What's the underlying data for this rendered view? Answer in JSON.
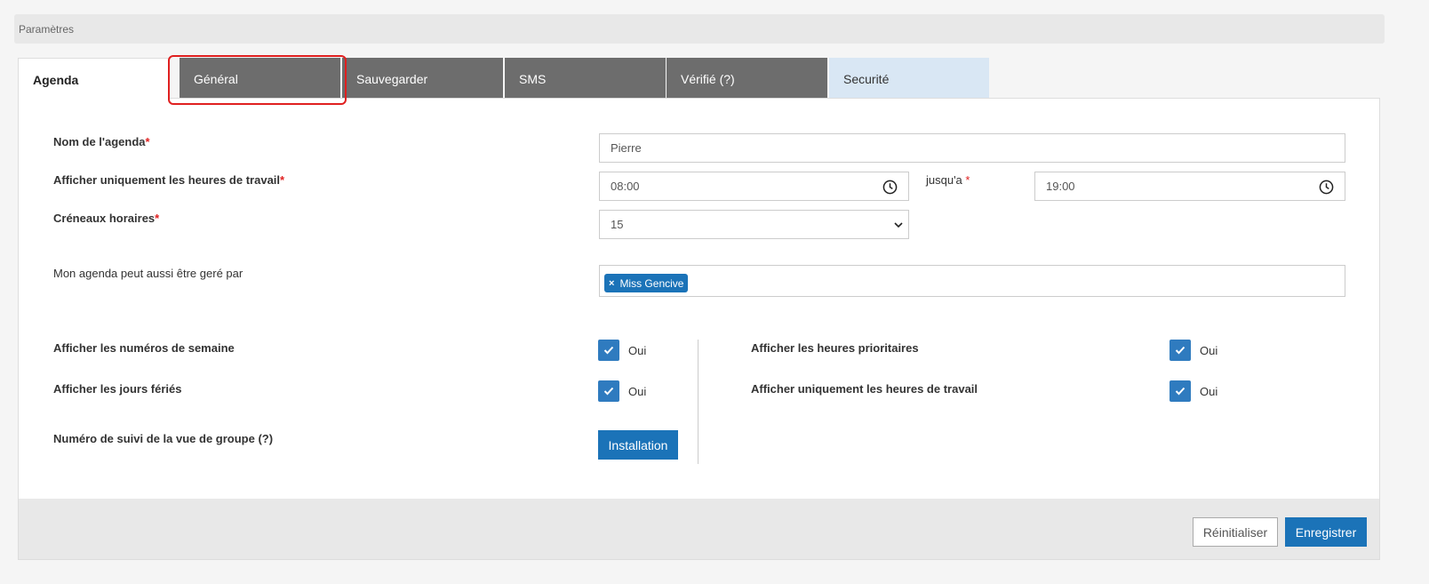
{
  "breadcrumb": "Paramètres",
  "tabs": {
    "agenda": "Agenda",
    "general": "Général",
    "save": "Sauvegarder",
    "sms": "SMS",
    "verified": "Vérifié (?)",
    "security": "Securité"
  },
  "form": {
    "agenda_name_label": "Nom de l'agenda",
    "agenda_name_value": "Pierre",
    "work_hours_label": "Afficher uniquement les heures de travail",
    "start_time": "08:00",
    "until_label": "jusqu'a",
    "end_time": "19:00",
    "slots_label": "Créneaux horaires",
    "slots_value": "15",
    "managed_by_label": "Mon agenda peut aussi être geré par",
    "managed_by_tag": "Miss Gencive",
    "tag_remove": "×",
    "required_mark": "*"
  },
  "options": {
    "week_numbers_label": "Afficher les numéros de semaine",
    "holidays_label": "Afficher les jours fériés",
    "priority_hours_label": "Afficher les heures prioritaires",
    "only_work_hours_label": "Afficher uniquement les heures de travail",
    "yes": "Oui",
    "tracking_label": "Numéro de suivi de la vue de groupe (?)",
    "install_button": "Installation"
  },
  "footer": {
    "reset_button": "Réinitialiser",
    "save_button": "Enregistrer"
  },
  "colors": {
    "primary": "#1b73b8",
    "tab_dark": "#6d6d6d",
    "tab_light": "#d9e7f4",
    "highlight": "#e02020"
  }
}
